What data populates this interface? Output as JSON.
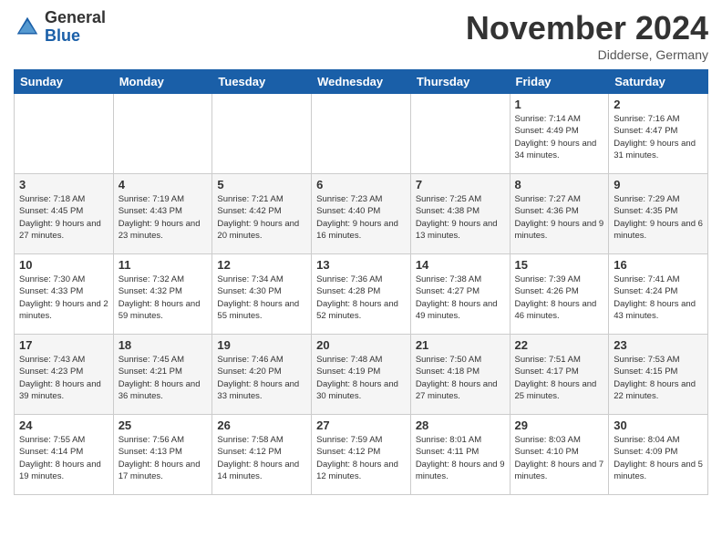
{
  "logo": {
    "general": "General",
    "blue": "Blue"
  },
  "header": {
    "title": "November 2024",
    "subtitle": "Didderse, Germany"
  },
  "weekdays": [
    "Sunday",
    "Monday",
    "Tuesday",
    "Wednesday",
    "Thursday",
    "Friday",
    "Saturday"
  ],
  "weeks": [
    [
      {
        "day": "",
        "info": ""
      },
      {
        "day": "",
        "info": ""
      },
      {
        "day": "",
        "info": ""
      },
      {
        "day": "",
        "info": ""
      },
      {
        "day": "",
        "info": ""
      },
      {
        "day": "1",
        "info": "Sunrise: 7:14 AM\nSunset: 4:49 PM\nDaylight: 9 hours and 34 minutes."
      },
      {
        "day": "2",
        "info": "Sunrise: 7:16 AM\nSunset: 4:47 PM\nDaylight: 9 hours and 31 minutes."
      }
    ],
    [
      {
        "day": "3",
        "info": "Sunrise: 7:18 AM\nSunset: 4:45 PM\nDaylight: 9 hours and 27 minutes."
      },
      {
        "day": "4",
        "info": "Sunrise: 7:19 AM\nSunset: 4:43 PM\nDaylight: 9 hours and 23 minutes."
      },
      {
        "day": "5",
        "info": "Sunrise: 7:21 AM\nSunset: 4:42 PM\nDaylight: 9 hours and 20 minutes."
      },
      {
        "day": "6",
        "info": "Sunrise: 7:23 AM\nSunset: 4:40 PM\nDaylight: 9 hours and 16 minutes."
      },
      {
        "day": "7",
        "info": "Sunrise: 7:25 AM\nSunset: 4:38 PM\nDaylight: 9 hours and 13 minutes."
      },
      {
        "day": "8",
        "info": "Sunrise: 7:27 AM\nSunset: 4:36 PM\nDaylight: 9 hours and 9 minutes."
      },
      {
        "day": "9",
        "info": "Sunrise: 7:29 AM\nSunset: 4:35 PM\nDaylight: 9 hours and 6 minutes."
      }
    ],
    [
      {
        "day": "10",
        "info": "Sunrise: 7:30 AM\nSunset: 4:33 PM\nDaylight: 9 hours and 2 minutes."
      },
      {
        "day": "11",
        "info": "Sunrise: 7:32 AM\nSunset: 4:32 PM\nDaylight: 8 hours and 59 minutes."
      },
      {
        "day": "12",
        "info": "Sunrise: 7:34 AM\nSunset: 4:30 PM\nDaylight: 8 hours and 55 minutes."
      },
      {
        "day": "13",
        "info": "Sunrise: 7:36 AM\nSunset: 4:28 PM\nDaylight: 8 hours and 52 minutes."
      },
      {
        "day": "14",
        "info": "Sunrise: 7:38 AM\nSunset: 4:27 PM\nDaylight: 8 hours and 49 minutes."
      },
      {
        "day": "15",
        "info": "Sunrise: 7:39 AM\nSunset: 4:26 PM\nDaylight: 8 hours and 46 minutes."
      },
      {
        "day": "16",
        "info": "Sunrise: 7:41 AM\nSunset: 4:24 PM\nDaylight: 8 hours and 43 minutes."
      }
    ],
    [
      {
        "day": "17",
        "info": "Sunrise: 7:43 AM\nSunset: 4:23 PM\nDaylight: 8 hours and 39 minutes."
      },
      {
        "day": "18",
        "info": "Sunrise: 7:45 AM\nSunset: 4:21 PM\nDaylight: 8 hours and 36 minutes."
      },
      {
        "day": "19",
        "info": "Sunrise: 7:46 AM\nSunset: 4:20 PM\nDaylight: 8 hours and 33 minutes."
      },
      {
        "day": "20",
        "info": "Sunrise: 7:48 AM\nSunset: 4:19 PM\nDaylight: 8 hours and 30 minutes."
      },
      {
        "day": "21",
        "info": "Sunrise: 7:50 AM\nSunset: 4:18 PM\nDaylight: 8 hours and 27 minutes."
      },
      {
        "day": "22",
        "info": "Sunrise: 7:51 AM\nSunset: 4:17 PM\nDaylight: 8 hours and 25 minutes."
      },
      {
        "day": "23",
        "info": "Sunrise: 7:53 AM\nSunset: 4:15 PM\nDaylight: 8 hours and 22 minutes."
      }
    ],
    [
      {
        "day": "24",
        "info": "Sunrise: 7:55 AM\nSunset: 4:14 PM\nDaylight: 8 hours and 19 minutes."
      },
      {
        "day": "25",
        "info": "Sunrise: 7:56 AM\nSunset: 4:13 PM\nDaylight: 8 hours and 17 minutes."
      },
      {
        "day": "26",
        "info": "Sunrise: 7:58 AM\nSunset: 4:12 PM\nDaylight: 8 hours and 14 minutes."
      },
      {
        "day": "27",
        "info": "Sunrise: 7:59 AM\nSunset: 4:12 PM\nDaylight: 8 hours and 12 minutes."
      },
      {
        "day": "28",
        "info": "Sunrise: 8:01 AM\nSunset: 4:11 PM\nDaylight: 8 hours and 9 minutes."
      },
      {
        "day": "29",
        "info": "Sunrise: 8:03 AM\nSunset: 4:10 PM\nDaylight: 8 hours and 7 minutes."
      },
      {
        "day": "30",
        "info": "Sunrise: 8:04 AM\nSunset: 4:09 PM\nDaylight: 8 hours and 5 minutes."
      }
    ]
  ]
}
